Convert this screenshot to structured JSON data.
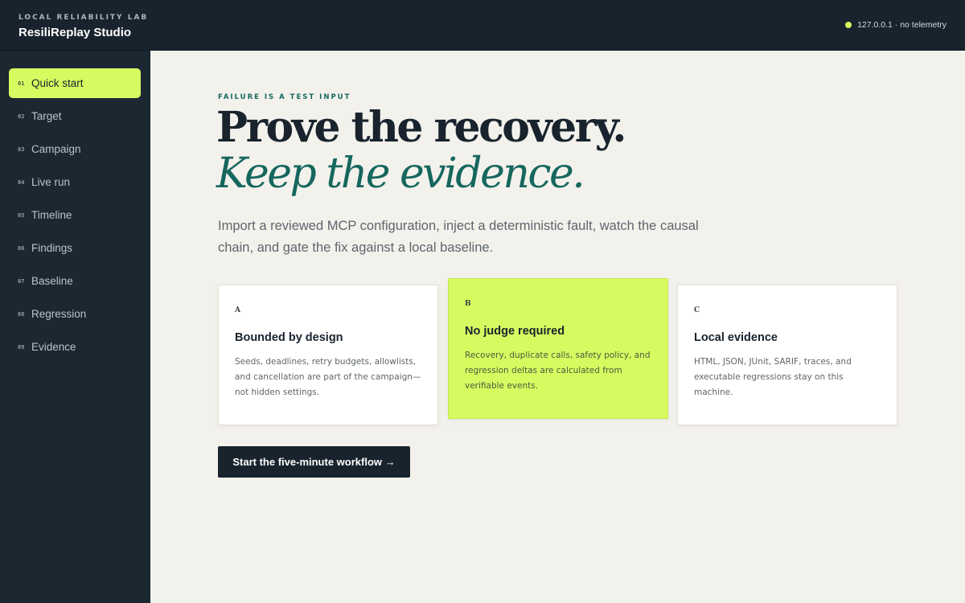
{
  "header": {
    "eyebrow": "LOCAL RELIABILITY LAB",
    "title": "ResiliReplay Studio",
    "status": "127.0.0.1 · no telemetry",
    "status_color": "#d6fb60"
  },
  "sidebar": {
    "items": [
      {
        "num": "01",
        "label": "Quick start",
        "active": true
      },
      {
        "num": "02",
        "label": "Target"
      },
      {
        "num": "03",
        "label": "Campaign"
      },
      {
        "num": "04",
        "label": "Live run"
      },
      {
        "num": "05",
        "label": "Timeline"
      },
      {
        "num": "06",
        "label": "Findings"
      },
      {
        "num": "07",
        "label": "Baseline"
      },
      {
        "num": "08",
        "label": "Regression"
      },
      {
        "num": "09",
        "label": "Evidence"
      }
    ]
  },
  "hero": {
    "eyebrow": "FAILURE IS A TEST INPUT",
    "headline_1": "Prove the recovery.",
    "headline_2": "Keep the evidence.",
    "lede": "Import a reviewed MCP configuration, inject a deterministic fault, watch the causal chain, and gate the fix against a local baseline."
  },
  "cards": [
    {
      "letter": "A",
      "title": "Bounded by design",
      "body": "Seeds, deadlines, retry budgets, allowlists, and cancellation are part of the campaign—not hidden settings."
    },
    {
      "letter": "B",
      "title": "No judge required",
      "body": "Recovery, duplicate calls, safety policy, and regression deltas are calculated from verifiable events.",
      "highlighted": true
    },
    {
      "letter": "C",
      "title": "Local evidence",
      "body": "HTML, JSON, JUnit, SARIF, traces, and executable regressions stay on this machine."
    }
  ],
  "cta": {
    "label": "Start the five-minute workflow →"
  },
  "colors": {
    "accent": "#d6fb60",
    "dark": "#18232d",
    "teal": "#16675e"
  }
}
